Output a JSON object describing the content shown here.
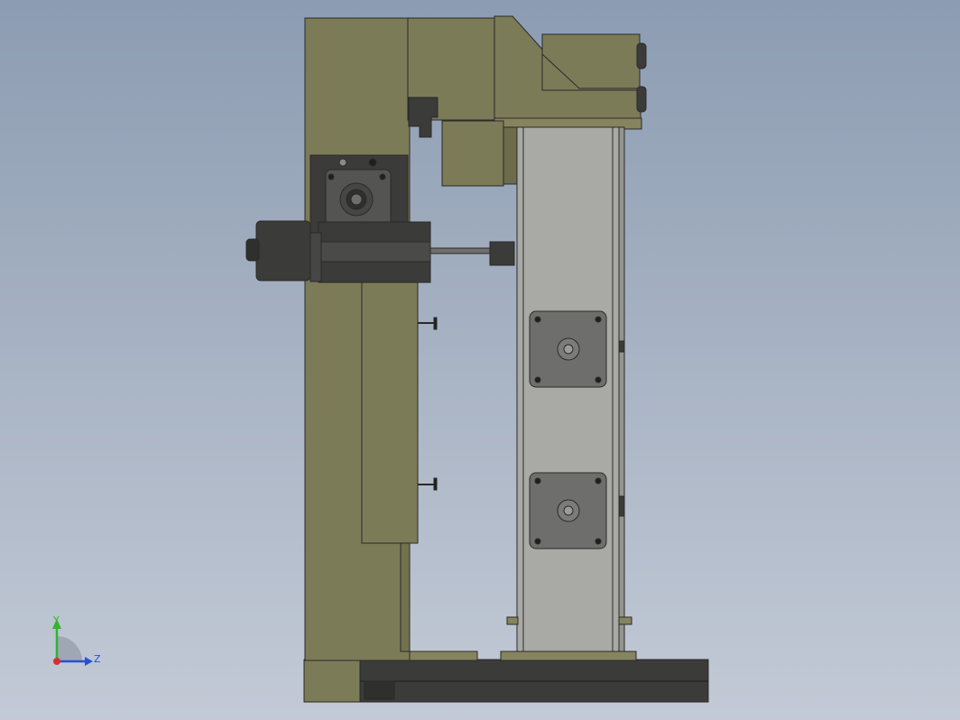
{
  "viewport": {
    "colors": {
      "background_top": "#8c9cb2",
      "background_bottom": "#c3cad6",
      "frame_olive": "#7c7b58",
      "frame_olive_light": "#86845e",
      "column_gray": "#a9aaa6",
      "motor_gray": "#6e6f6c",
      "dark_part": "#3b3b3a",
      "edge_line": "#2a2a28"
    }
  },
  "triad": {
    "y_label": "Y",
    "z_label": "Z",
    "y_color": "#2fb52f",
    "z_color": "#2a4fd8",
    "x_color": "#d83030",
    "icon": "view-orientation-triad"
  }
}
